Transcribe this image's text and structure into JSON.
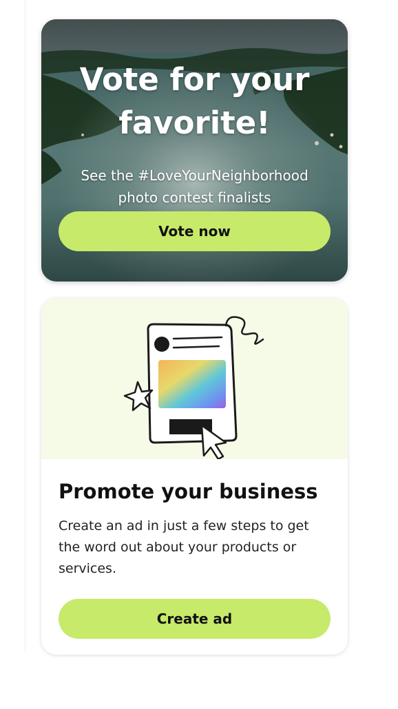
{
  "vote_card": {
    "title": "Vote for your\nfavorite!",
    "subtitle": "See the #LoveYourNeighborhood\nphoto contest finalists",
    "button_label": "Vote now"
  },
  "promo_card": {
    "title": "Promote your business",
    "description": "Create an ad in just a few steps to get the word out about your products or services.",
    "button_label": "Create ad"
  },
  "colors": {
    "accent_button": "#c7ea6a",
    "promo_hero_bg": "#f6fbe8",
    "text_dark": "#111111"
  },
  "icons": [
    "star-icon",
    "cursor-arrow-icon",
    "ad-document-illustration",
    "lake-aerial-photo"
  ]
}
